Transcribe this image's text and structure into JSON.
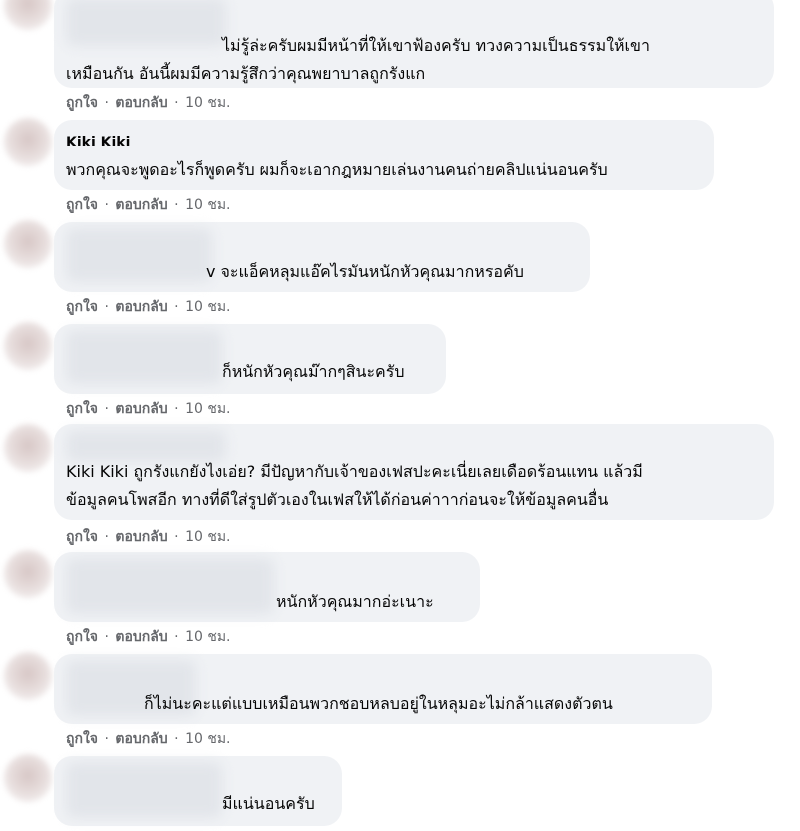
{
  "actions": {
    "like": "ถูกใจ",
    "reply": "ตอบกลับ",
    "time": "10 ชม.",
    "separator": "·"
  },
  "comments": [
    {
      "author": "",
      "lines": [
        "ไม่รู้ล่ะครับผมมีหน้าที่ให้เขาฟ้องครับ ทวงความเป็นธรรมให้เขา",
        "เหมือนกัน อันนี้ผมมีความรู้สึกว่าคุณพยาบาลถูกรังแก"
      ]
    },
    {
      "author": "Kiki Kiki",
      "lines": [
        "พวกคุณจะพูดอะไรก็พูดครับ ผมก็จะเอากฎหมายเล่นงานคนถ่ายคลิปแน่นอนครับ"
      ]
    },
    {
      "author": "",
      "lines": [
        "v จะแอ็คหลุมแอ๊คไรมันหนักหัวคุณมากหรอคับ"
      ]
    },
    {
      "author": "",
      "lines": [
        "ก็หนักหัวคุณม๊ากๆสินะครับ"
      ]
    },
    {
      "author": "",
      "lines": [
        "Kiki Kiki ถูกรังแกยังไงเอ่ย? มีปัญหากับเจ้าของเฟสปะคะเนี่ยเลยเดือดร้อนแทน แล้วมี",
        "ข้อมูลคนโพสอีก ทางที่ดีใส่รูปตัวเองในเฟสให้ได้ก่อนค่าาาก่อนจะให้ข้อมูลคนอื่น"
      ]
    },
    {
      "author": "",
      "lines": [
        "หนักหัวคุณมากอ่ะเนาะ"
      ]
    },
    {
      "author": "",
      "lines": [
        "ก็ไม่นะคะแต่แบบเหมือนพวกชอบหลบอยู่ในหลุมอะไม่กล้าแสดงตัวตน"
      ]
    },
    {
      "author": "",
      "lines": [
        "มีแน่นอนครับ"
      ]
    }
  ]
}
